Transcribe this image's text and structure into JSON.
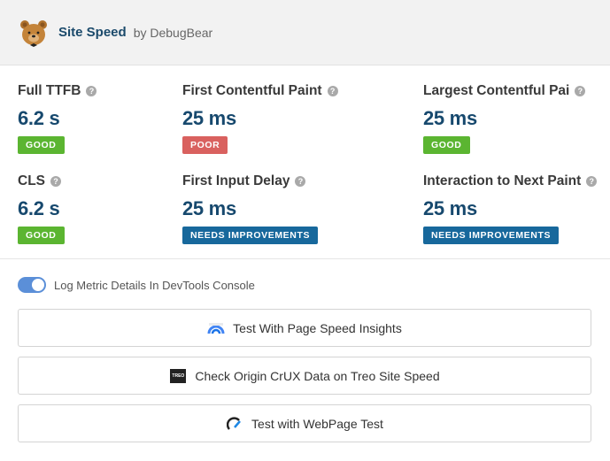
{
  "header": {
    "title": "Site Speed",
    "byline": "by DebugBear",
    "logo_icon": "bear-logo-icon"
  },
  "metrics": [
    {
      "label": "Full TTFB",
      "value": "6.2 s",
      "badge": "GOOD",
      "status": "good"
    },
    {
      "label": "First Contentful Paint",
      "value": "25 ms",
      "badge": "POOR",
      "status": "poor"
    },
    {
      "label": "Largest Contentful Pai",
      "value": "25 ms",
      "badge": "GOOD",
      "status": "good"
    },
    {
      "label": "CLS",
      "value": "6.2 s",
      "badge": "GOOD",
      "status": "good"
    },
    {
      "label": "First Input Delay",
      "value": "25 ms",
      "badge": "NEEDS IMPROVEMENTS",
      "status": "needs"
    },
    {
      "label": "Interaction to Next Paint",
      "value": "25 ms",
      "badge": "NEEDS IMPROVEMENTS",
      "status": "needs"
    }
  ],
  "help_glyph": "?",
  "toggle": {
    "label": "Log Metric Details In DevTools Console",
    "on": true
  },
  "buttons": [
    {
      "label": "Test With Page Speed Insights",
      "icon": "pagespeed-icon"
    },
    {
      "label": "Check Origin CrUX Data on Treo Site Speed",
      "icon": "treo-icon",
      "icon_text": "TREO"
    },
    {
      "label": "Test with WebPage Test",
      "icon": "webpagetest-icon"
    }
  ],
  "colors": {
    "good": "#5bb531",
    "poor": "#d9615f",
    "needs": "#17689c",
    "value": "#17496e",
    "toggle": "#5b8fd8"
  }
}
